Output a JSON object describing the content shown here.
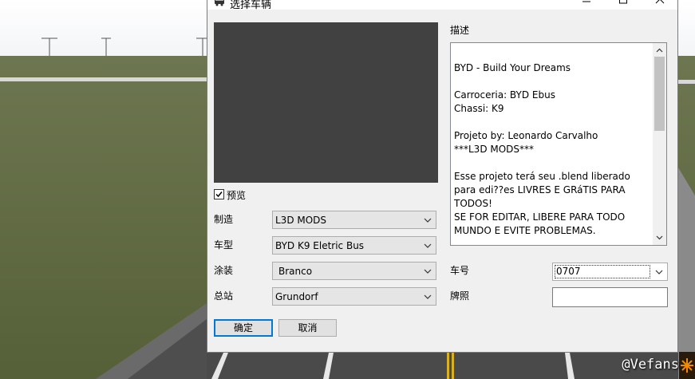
{
  "window": {
    "title": "选择车辆",
    "controls": {
      "minimize": "minimize",
      "maximize": "maximize",
      "close": "close"
    }
  },
  "preview": {
    "checkbox_label": "预览",
    "checked": true
  },
  "fields": {
    "make": {
      "label": "制造",
      "value": "L3D MODS"
    },
    "model": {
      "label": "车型",
      "value": "BYD K9 Eletric Bus"
    },
    "livery": {
      "label": "涂装",
      "value": "Branco"
    },
    "depot": {
      "label": "总站",
      "value": "Grundorf"
    },
    "bus_number": {
      "label": "车号",
      "value": "0707"
    },
    "plate": {
      "label": "牌照",
      "value": ""
    }
  },
  "description": {
    "label": "描述",
    "text": "\nBYD - Build Your Dreams\n\nCarroceria: BYD Ebus\nChassi: K9\n\nProjeto by: Leonardo Carvalho\n***L3D MODS***\n\nEsse projeto terá seu .blend liberado para edi??es LIVRES E GRáTIS PARA TODOS!\nSE FOR EDITAR, LIBERE PARA TODO MUNDO E EVITE PROBLEMAS."
  },
  "buttons": {
    "ok": "确定",
    "cancel": "取消"
  },
  "overlay": {
    "watermark": "@Vefans"
  },
  "colors": {
    "preview_bg": "#414141",
    "focus_border": "#0078d7",
    "dialog_bg": "#f0f0f0"
  }
}
